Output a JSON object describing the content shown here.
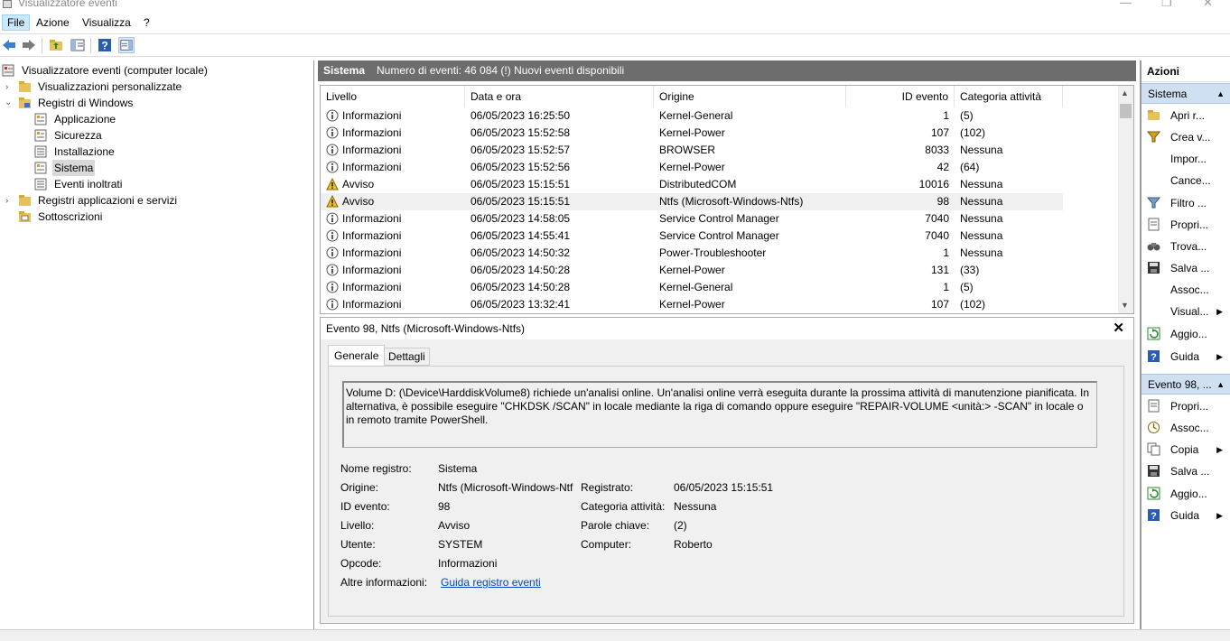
{
  "window": {
    "title": "Visualizzatore eventi"
  },
  "menu": [
    "File",
    "Azione",
    "Visualizza",
    "?"
  ],
  "tree": {
    "root": "Visualizzatore eventi (computer locale)",
    "custom_views": "Visualizzazioni personalizzate",
    "windows_logs": "Registri di Windows",
    "logs": [
      "Applicazione",
      "Sicurezza",
      "Installazione",
      "Sistema",
      "Eventi inoltrati"
    ],
    "apps_services": "Registri applicazioni e servizi",
    "subscriptions": "Sottoscrizioni"
  },
  "header": {
    "name": "Sistema",
    "count": "Numero di eventi: 46 084 (!) Nuovi eventi disponibili"
  },
  "grid": {
    "columns": [
      "Livello",
      "Data e ora",
      "Origine",
      "ID evento",
      "Categoria attività"
    ],
    "rows": [
      {
        "level": "Informazioni",
        "type": "info",
        "date": "06/05/2023 16:25:50",
        "source": "Kernel-General",
        "id": "1",
        "cat": "(5)"
      },
      {
        "level": "Informazioni",
        "type": "info",
        "date": "06/05/2023 15:52:58",
        "source": "Kernel-Power",
        "id": "107",
        "cat": "(102)"
      },
      {
        "level": "Informazioni",
        "type": "info",
        "date": "06/05/2023 15:52:57",
        "source": "BROWSER",
        "id": "8033",
        "cat": "Nessuna"
      },
      {
        "level": "Informazioni",
        "type": "info",
        "date": "06/05/2023 15:52:56",
        "source": "Kernel-Power",
        "id": "42",
        "cat": "(64)"
      },
      {
        "level": "Avviso",
        "type": "warn",
        "date": "06/05/2023 15:15:51",
        "source": "DistributedCOM",
        "id": "10016",
        "cat": "Nessuna"
      },
      {
        "level": "Avviso",
        "type": "warn",
        "date": "06/05/2023 15:15:51",
        "source": "Ntfs (Microsoft-Windows-Ntfs)",
        "id": "98",
        "cat": "Nessuna"
      },
      {
        "level": "Informazioni",
        "type": "info",
        "date": "06/05/2023 14:58:05",
        "source": "Service Control Manager",
        "id": "7040",
        "cat": "Nessuna"
      },
      {
        "level": "Informazioni",
        "type": "info",
        "date": "06/05/2023 14:55:41",
        "source": "Service Control Manager",
        "id": "7040",
        "cat": "Nessuna"
      },
      {
        "level": "Informazioni",
        "type": "info",
        "date": "06/05/2023 14:50:32",
        "source": "Power-Troubleshooter",
        "id": "1",
        "cat": "Nessuna"
      },
      {
        "level": "Informazioni",
        "type": "info",
        "date": "06/05/2023 14:50:28",
        "source": "Kernel-Power",
        "id": "131",
        "cat": "(33)"
      },
      {
        "level": "Informazioni",
        "type": "info",
        "date": "06/05/2023 14:50:28",
        "source": "Kernel-General",
        "id": "1",
        "cat": "(5)"
      },
      {
        "level": "Informazioni",
        "type": "info",
        "date": "06/05/2023 13:32:41",
        "source": "Kernel-Power",
        "id": "107",
        "cat": "(102)"
      }
    ]
  },
  "details": {
    "title": "Evento 98, Ntfs (Microsoft-Windows-Ntfs)",
    "tabs": [
      "Generale",
      "Dettagli"
    ],
    "description": "Volume D: (\\Device\\HarddiskVolume8) richiede un'analisi online. Un'analisi online verrà eseguita durante la prossima attività di manutenzione pianificata. In alternativa, è possibile eseguire \"CHKDSK /SCAN\" in locale mediante la riga di comando oppure eseguire \"REPAIR-VOLUME <unità:> -SCAN\" in locale o in remoto tramite PowerShell.",
    "labels": {
      "log_name": "Nome registro:",
      "source": "Origine:",
      "event_id": "ID evento:",
      "level": "Livello:",
      "user": "Utente:",
      "opcode": "Opcode:",
      "more_info": "Altre informazioni:",
      "logged": "Registrato:",
      "task_category": "Categoria attività:",
      "keywords": "Parole chiave:",
      "computer": "Computer:"
    },
    "values": {
      "log_name": "Sistema",
      "source": "Ntfs (Microsoft-Windows-Ntfs)",
      "event_id": "98",
      "level": "Avviso",
      "user": "SYSTEM",
      "opcode": "Informazioni",
      "more_info_link": "Guida registro eventi",
      "logged": "06/05/2023 15:15:51",
      "task_category": "Nessuna",
      "keywords": "(2)",
      "computer": "Roberto"
    }
  },
  "actions": {
    "title": "Azioni",
    "section1": "Sistema",
    "items1": [
      "Apri r...",
      "Crea v...",
      "Impor...",
      "Cance...",
      "Filtro ...",
      "Propri...",
      "Trova...",
      "Salva ...",
      "Assoc...",
      "Visual...",
      "Aggio...",
      "Guida"
    ],
    "section2": "Evento 98, ...",
    "items2": [
      "Propri...",
      "Assoc...",
      "Copia",
      "Salva ...",
      "Aggio...",
      "Guida"
    ]
  },
  "colors": {
    "header_bg": "#6d6d6d",
    "section_bg": "#cfe0f3",
    "link": "#0645c8"
  }
}
